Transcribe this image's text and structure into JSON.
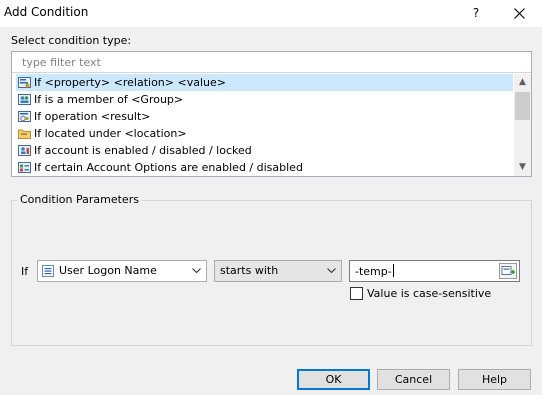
{
  "window": {
    "title": "Add Condition",
    "help_label": "?"
  },
  "condition_types": {
    "label": "Select condition type:",
    "filter_placeholder": "type filter text",
    "items": [
      {
        "label": "If <property> <relation> <value>",
        "selected": true,
        "icon": "property-condition-icon"
      },
      {
        "label": "If is a member of <Group>",
        "selected": false,
        "icon": "group-condition-icon"
      },
      {
        "label": "If operation <result>",
        "selected": false,
        "icon": "operation-condition-icon"
      },
      {
        "label": "If located under <location>",
        "selected": false,
        "icon": "folder-condition-icon"
      },
      {
        "label": "If account is enabled / disabled / locked",
        "selected": false,
        "icon": "account-condition-icon"
      },
      {
        "label": "If certain Account Options are enabled / disabled",
        "selected": false,
        "icon": "account-options-condition-icon"
      }
    ]
  },
  "parameters": {
    "legend": "Condition Parameters",
    "if_label": "If",
    "property_value": "User Logon Name",
    "relation_value": "starts with",
    "value_text": "-temp-",
    "case_sensitive_label": "Value is case-sensitive",
    "case_sensitive_checked": false
  },
  "buttons": {
    "ok": "OK",
    "cancel": "Cancel",
    "help": "Help"
  }
}
